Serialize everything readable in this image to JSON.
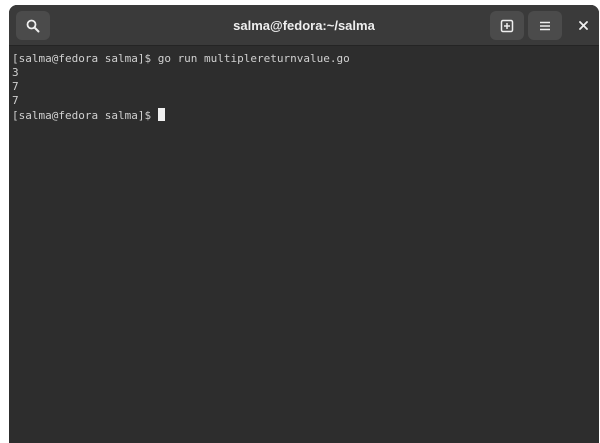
{
  "window": {
    "title": "salma@fedora:~/salma"
  },
  "header": {
    "buttons": [
      {
        "icon": "search-icon"
      },
      {
        "icon": "new-tab-icon"
      },
      {
        "icon": "hamburger-menu-icon"
      },
      {
        "icon": "close-icon"
      }
    ]
  },
  "terminal": {
    "lines": [
      "[salma@fedora salma]$ go run multiplereturnvalue.go",
      "3",
      "7",
      "7"
    ],
    "prompt": "[salma@fedora salma]$ "
  },
  "colors": {
    "background": "#2d2d2d",
    "headerbar": "#3a3a3a",
    "text": "#d0d0d0"
  }
}
